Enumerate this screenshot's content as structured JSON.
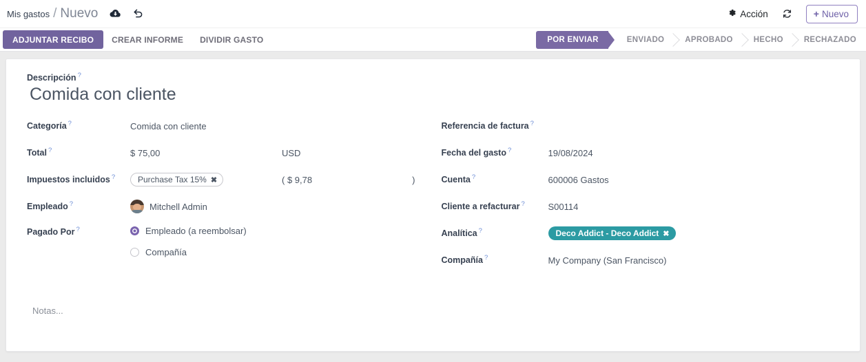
{
  "breadcrumb": {
    "parent": "Mis gastos",
    "separator": "/",
    "current": "Nuevo",
    "save_icon": "cloud-upload-icon",
    "discard_icon": "undo-icon"
  },
  "control_panel": {
    "action_label": "Acción",
    "action_icon": "gear-icon",
    "refresh_icon": "refresh-icon",
    "new_button": "Nuevo",
    "new_plus": "+"
  },
  "action_buttons": [
    {
      "label": "Adjuntar recibo",
      "style": "primary"
    },
    {
      "label": "Crear informe",
      "style": "secondary"
    },
    {
      "label": "Dividir gasto",
      "style": "secondary"
    }
  ],
  "statusbar": {
    "stages": [
      {
        "label": "Por enviar",
        "active": true
      },
      {
        "label": "Enviado",
        "active": false
      },
      {
        "label": "Aprobado",
        "active": false
      },
      {
        "label": "Hecho",
        "active": false
      },
      {
        "label": "Rechazado",
        "active": false
      }
    ]
  },
  "form": {
    "tip_marker": "?",
    "description": {
      "label": "Descripción",
      "value": "Comida con cliente"
    },
    "left": {
      "categoria": {
        "label": "Categoría",
        "value": "Comida con cliente"
      },
      "total": {
        "label": "Total",
        "value": "$ 75,00",
        "currency": "USD"
      },
      "impuestos": {
        "label": "Impuestos incluidos",
        "tag": "Purchase Tax 15%",
        "tag_remove": "✖",
        "amount_open": "( $ 9,78",
        "amount_close": ")"
      },
      "empleado": {
        "label": "Empleado",
        "value": "Mitchell Admin",
        "avatar": "avatar"
      },
      "pagado_por": {
        "label": "Pagado Por",
        "options": [
          {
            "label": "Empleado (a reembolsar)",
            "selected": true
          },
          {
            "label": "Compañía",
            "selected": false
          }
        ]
      }
    },
    "right": {
      "referencia": {
        "label": "Referencia de factura",
        "value": ""
      },
      "fecha": {
        "label": "Fecha del gasto",
        "value": "19/08/2024"
      },
      "cuenta": {
        "label": "Cuenta",
        "value": "600006 Gastos"
      },
      "cliente": {
        "label": "Cliente a refacturar",
        "value": "S00114"
      },
      "analitica": {
        "label": "Analítica",
        "tag": "Deco Addict - Deco Addict",
        "tag_remove": "✖"
      },
      "compania": {
        "label": "Compañía",
        "value": "My Company (San Francisco)"
      }
    },
    "notes_placeholder": "Notas..."
  },
  "colors": {
    "primary_purple": "#71639e",
    "status_purple": "#7a6aa4",
    "teal_tag": "#2c9ba3",
    "page_bg": "#ebebeb"
  }
}
